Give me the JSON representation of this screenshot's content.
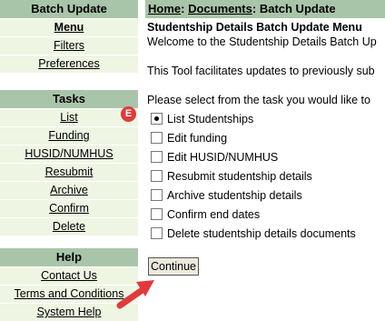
{
  "sidebar": {
    "batch_update": {
      "title": "Batch Update",
      "items": [
        {
          "label": "Menu"
        },
        {
          "label": "Filters"
        },
        {
          "label": "Preferences"
        }
      ]
    },
    "tasks": {
      "title": "Tasks",
      "items": [
        {
          "label": "List"
        },
        {
          "label": "Funding"
        },
        {
          "label": "HUSID/NUMHUS"
        },
        {
          "label": "Resubmit"
        },
        {
          "label": "Archive"
        },
        {
          "label": "Confirm"
        },
        {
          "label": "Delete"
        }
      ]
    },
    "help": {
      "title": "Help",
      "items": [
        {
          "label": "Contact Us"
        },
        {
          "label": "Terms and Conditions"
        },
        {
          "label": "System Help"
        }
      ]
    }
  },
  "breadcrumb": {
    "home": "Home",
    "sep1": ": ",
    "documents": "Documents",
    "sep2": ": ",
    "current": "Batch Update"
  },
  "main": {
    "title": "Studentship Details Batch Update Menu",
    "welcome": "Welcome to the Studentship Details Batch Up",
    "description": "This Tool facilitates updates to previously sub",
    "prompt": "Please select from the task you would like to",
    "options": [
      {
        "label": "List Studentships",
        "selected": true
      },
      {
        "label": "Edit funding",
        "selected": false
      },
      {
        "label": "Edit HUSID/NUMHUS",
        "selected": false
      },
      {
        "label": "Resubmit studentship details",
        "selected": false
      },
      {
        "label": "Archive studentship details",
        "selected": false
      },
      {
        "label": "Confirm end dates",
        "selected": false
      },
      {
        "label": "Delete studentship details documents",
        "selected": false
      }
    ],
    "continue_label": "Continue"
  },
  "annotation": {
    "badge_letter": "E",
    "badge_color": "#e03a3a",
    "arrow_color": "#e03a3a"
  },
  "colors": {
    "panel_header": "#a9c5a9",
    "panel_item": "#eef5e3"
  }
}
